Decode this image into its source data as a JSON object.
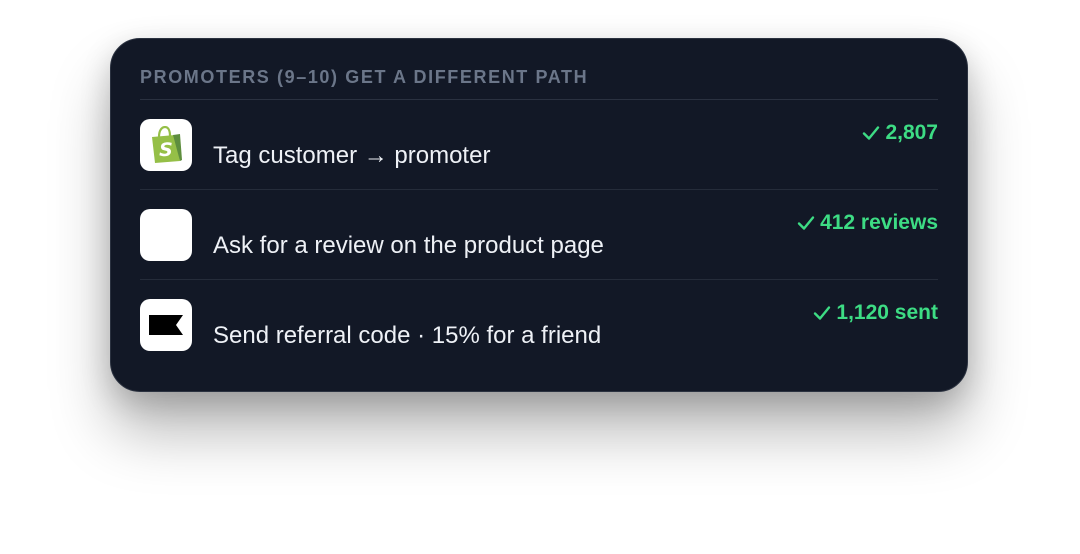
{
  "card": {
    "heading": "PROMOTERS (9–10) GET A DIFFERENT PATH"
  },
  "rows": [
    {
      "icon": "shopify-icon",
      "label": "Tag customer → promoter",
      "status": "2,807"
    },
    {
      "icon": "blank-app-icon",
      "label": "Ask for a review on the product page",
      "status": "412 reviews"
    },
    {
      "icon": "klaviyo-flag-icon",
      "label": "Send referral code · 15% for a friend",
      "status": "1,120 sent"
    }
  ],
  "colors": {
    "card_background": "#121826",
    "heading": "#6b7689",
    "status_green": "#3ddc84",
    "shopify_green": "#95bf47"
  }
}
